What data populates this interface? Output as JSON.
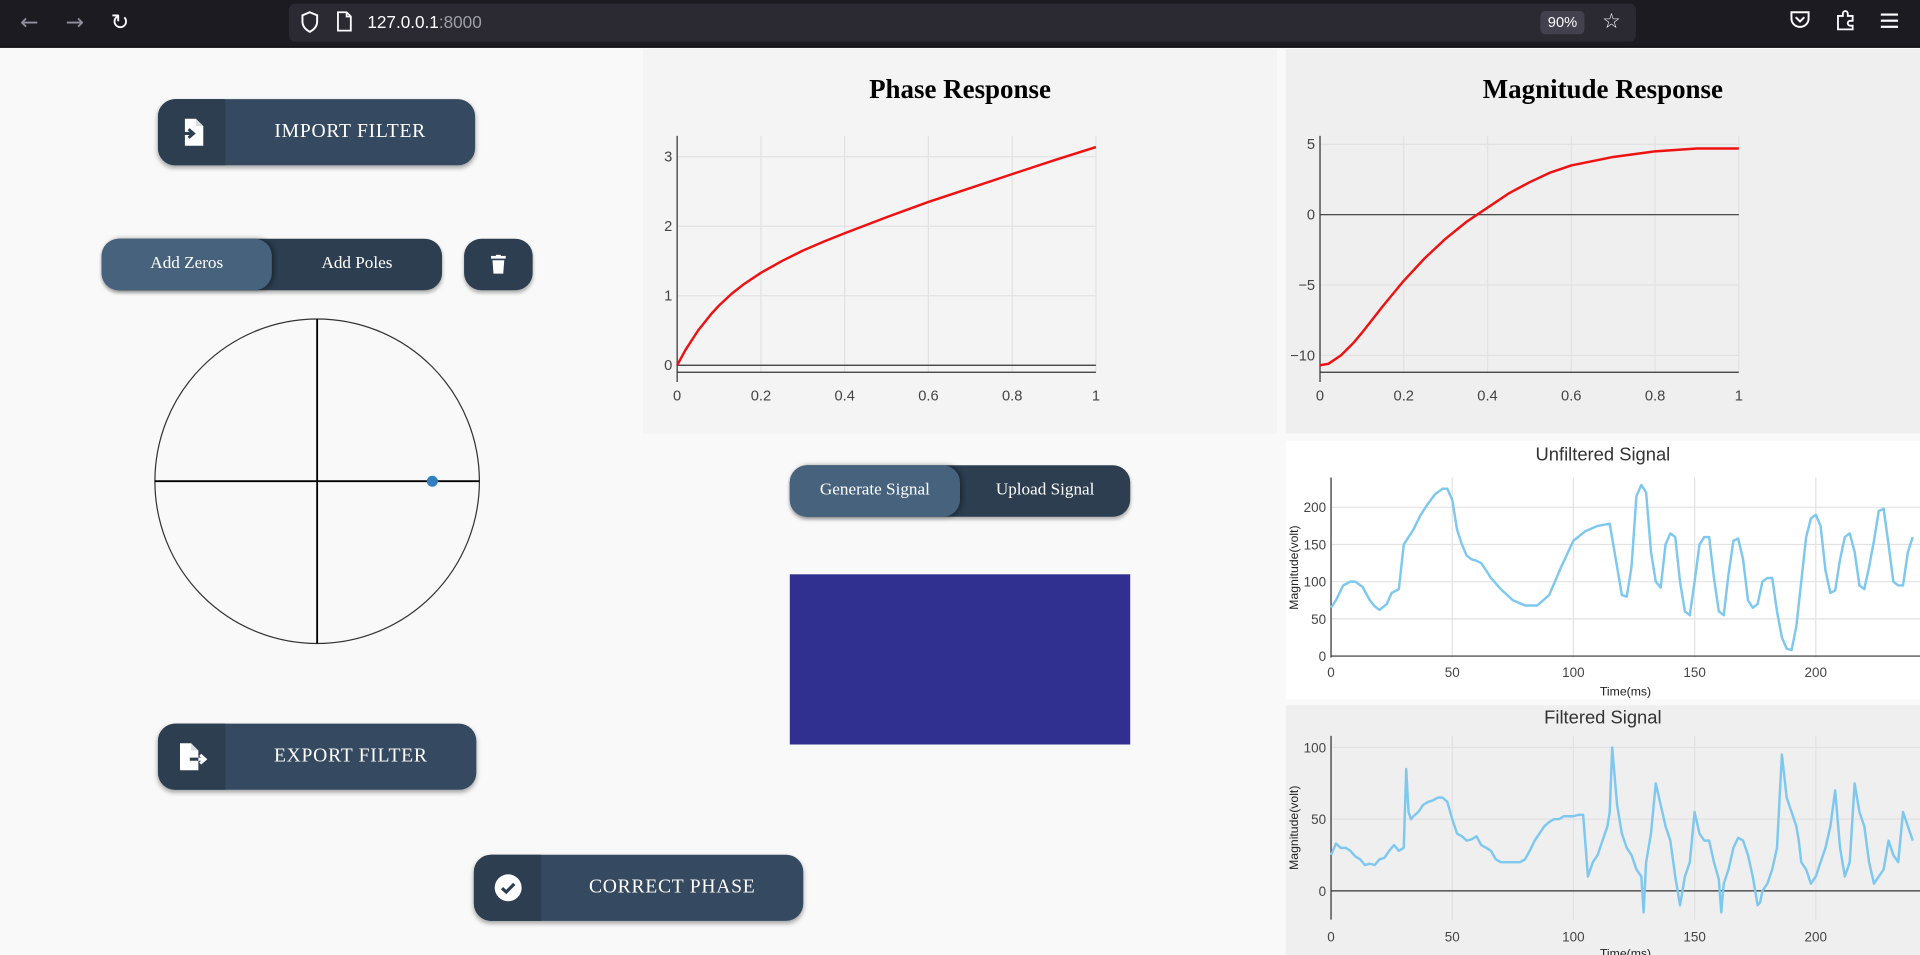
{
  "browser": {
    "url_host": "127.0.0.1",
    "url_port": ":8000",
    "zoom": "90%",
    "icons": [
      "back-icon",
      "forward-icon",
      "reload-icon",
      "shield-icon",
      "page-icon",
      "star-icon",
      "pocket-icon",
      "extensions-icon",
      "menu-icon"
    ]
  },
  "controls": {
    "import_label": "IMPORT FILTER",
    "export_label": "EXPORT FILTER",
    "correct_phase_label": "CORRECT PHASE",
    "add_zeros_label": "Add Zeros",
    "add_poles_label": "Add Poles",
    "generate_signal_label": "Generate Signal",
    "upload_signal_label": "Upload Signal"
  },
  "zplane": {
    "zeros": [],
    "poles": [
      {
        "re": 0.71,
        "im": 0.0
      }
    ],
    "marker_color": "#2f7fc1"
  },
  "signal_pad": {
    "color": "#303090"
  },
  "phase_chart": {
    "title": "Phase Response",
    "chart_data": {
      "type": "line",
      "x": [
        0,
        0.02,
        0.05,
        0.08,
        0.1,
        0.13,
        0.16,
        0.2,
        0.25,
        0.3,
        0.35,
        0.4,
        0.5,
        0.6,
        0.7,
        0.8,
        0.9,
        1
      ],
      "y": [
        0,
        0.22,
        0.5,
        0.73,
        0.86,
        1.03,
        1.17,
        1.33,
        1.5,
        1.65,
        1.78,
        1.9,
        2.13,
        2.35,
        2.55,
        2.75,
        2.95,
        3.14
      ],
      "xticks": [
        "0",
        "0.2",
        "0.4",
        "0.6",
        "0.8",
        "1"
      ],
      "yticks": [
        "0",
        "1",
        "2",
        "3"
      ],
      "xlim": [
        0,
        1
      ],
      "ylim": [
        -0.1,
        3.3
      ],
      "color": "#ee1111",
      "grid": true
    }
  },
  "magnitude_chart": {
    "title": "Magnitude Response",
    "chart_data": {
      "type": "line",
      "x": [
        0,
        0.02,
        0.05,
        0.08,
        0.1,
        0.15,
        0.2,
        0.25,
        0.3,
        0.35,
        0.4,
        0.45,
        0.5,
        0.55,
        0.6,
        0.7,
        0.8,
        0.9,
        1
      ],
      "y": [
        -10.7,
        -10.6,
        -10.0,
        -9.1,
        -8.4,
        -6.5,
        -4.7,
        -3.1,
        -1.7,
        -0.5,
        0.5,
        1.5,
        2.3,
        3.0,
        3.5,
        4.1,
        4.5,
        4.7,
        4.7
      ],
      "xticks": [
        "0",
        "0.2",
        "0.4",
        "0.6",
        "0.8",
        "1"
      ],
      "yticks": [
        "−10",
        "−5",
        "0",
        "5"
      ],
      "xlim": [
        0,
        1
      ],
      "ylim": [
        -11.2,
        5.6
      ],
      "color": "#ee1111",
      "grid": true
    }
  },
  "unfiltered_chart": {
    "title": "Unfiltered Signal",
    "chart_data": {
      "type": "line",
      "x": [
        0,
        2,
        5,
        8,
        10,
        13,
        16,
        18,
        20,
        23,
        25,
        28,
        30,
        32,
        34,
        37,
        40,
        43,
        46,
        48,
        50,
        52,
        54,
        56,
        58,
        60,
        62,
        64,
        66,
        70,
        75,
        80,
        85,
        90,
        95,
        100,
        105,
        110,
        115,
        118,
        120,
        122,
        124,
        126,
        128,
        130,
        132,
        134,
        136,
        138,
        140,
        142,
        144,
        146,
        148,
        150,
        152,
        154,
        156,
        158,
        160,
        162,
        164,
        166,
        168,
        170,
        172,
        174,
        176,
        178,
        180,
        182,
        184,
        186,
        188,
        190,
        192,
        194,
        196,
        198,
        200,
        202,
        204,
        206,
        208,
        210,
        212,
        214,
        216,
        218,
        220,
        222,
        224,
        226,
        228,
        230,
        232,
        234,
        236,
        238,
        240
      ],
      "y": [
        65,
        75,
        95,
        100,
        100,
        93,
        75,
        67,
        62,
        70,
        85,
        90,
        150,
        160,
        170,
        190,
        205,
        218,
        225,
        225,
        210,
        170,
        150,
        135,
        130,
        128,
        125,
        115,
        105,
        90,
        75,
        68,
        68,
        82,
        120,
        155,
        168,
        175,
        178,
        120,
        82,
        80,
        120,
        215,
        230,
        220,
        140,
        100,
        92,
        150,
        165,
        160,
        100,
        60,
        55,
        100,
        150,
        160,
        160,
        105,
        60,
        55,
        110,
        155,
        158,
        130,
        75,
        65,
        70,
        100,
        105,
        105,
        60,
        25,
        10,
        8,
        40,
        100,
        160,
        185,
        190,
        175,
        115,
        85,
        88,
        130,
        160,
        165,
        140,
        95,
        90,
        120,
        155,
        195,
        198,
        150,
        100,
        95,
        95,
        140,
        160
      ],
      "xticks": [
        "0",
        "50",
        "100",
        "150",
        "200"
      ],
      "yticks": [
        "0",
        "50",
        "100",
        "150",
        "200"
      ],
      "xlabel": "Time(ms)",
      "ylabel": "Magnitude(volt)",
      "xlim": [
        0,
        243
      ],
      "ylim": [
        -2,
        240
      ],
      "color": "#7ec8f0",
      "grid": true
    }
  },
  "filtered_chart": {
    "title": "Filtered Signal",
    "chart_data": {
      "type": "line",
      "x": [
        0,
        2,
        4,
        6,
        8,
        10,
        12,
        14,
        16,
        18,
        20,
        22,
        24,
        26,
        28,
        30,
        31,
        32,
        33,
        34,
        36,
        38,
        40,
        42,
        44,
        46,
        48,
        50,
        52,
        54,
        56,
        58,
        60,
        62,
        64,
        66,
        68,
        70,
        72,
        74,
        76,
        78,
        80,
        82,
        84,
        86,
        88,
        90,
        92,
        94,
        96,
        98,
        100,
        102,
        104,
        106,
        108,
        110,
        112,
        114,
        115,
        116,
        118,
        120,
        122,
        124,
        126,
        128,
        129,
        130,
        132,
        134,
        136,
        138,
        140,
        142,
        144,
        145,
        146,
        148,
        150,
        152,
        154,
        156,
        158,
        160,
        161,
        162,
        164,
        166,
        168,
        170,
        172,
        174,
        176,
        177,
        178,
        180,
        182,
        184,
        186,
        188,
        190,
        192,
        193,
        194,
        196,
        198,
        200,
        202,
        204,
        206,
        208,
        210,
        212,
        213,
        214,
        216,
        218,
        220,
        222,
        224,
        226,
        228,
        230,
        232,
        234,
        236,
        238,
        240
      ],
      "y": [
        25,
        33,
        30,
        30,
        28,
        24,
        22,
        18,
        19,
        18,
        22,
        23,
        28,
        32,
        28,
        30,
        85,
        55,
        50,
        52,
        55,
        60,
        62,
        63,
        65,
        65,
        62,
        50,
        40,
        38,
        35,
        36,
        38,
        32,
        30,
        28,
        22,
        20,
        20,
        20,
        20,
        20,
        22,
        28,
        35,
        40,
        45,
        48,
        50,
        50,
        52,
        52,
        52,
        53,
        53,
        10,
        20,
        25,
        35,
        45,
        55,
        100,
        60,
        40,
        30,
        25,
        15,
        10,
        -15,
        20,
        40,
        75,
        60,
        45,
        35,
        10,
        -10,
        0,
        10,
        20,
        55,
        40,
        35,
        35,
        20,
        8,
        -15,
        5,
        15,
        30,
        37,
        35,
        25,
        10,
        -10,
        -8,
        0,
        5,
        15,
        30,
        95,
        65,
        55,
        45,
        35,
        20,
        15,
        5,
        10,
        20,
        30,
        45,
        70,
        30,
        10,
        15,
        20,
        75,
        55,
        45,
        20,
        5,
        10,
        15,
        35,
        25,
        20,
        55,
        45,
        35
      ],
      "xticks": [
        "0",
        "50",
        "100",
        "150",
        "200"
      ],
      "yticks": [
        "0",
        "50",
        "100"
      ],
      "xlabel": "Time(ms)",
      "ylabel": "Magnitude(volt)",
      "xlim": [
        0,
        243
      ],
      "ylim": [
        -20,
        108
      ],
      "color": "#7ec8f0",
      "grid": true
    }
  }
}
